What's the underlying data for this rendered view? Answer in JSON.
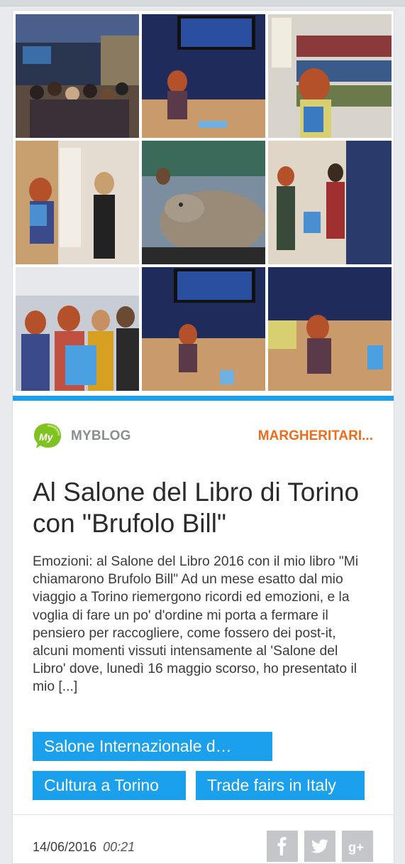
{
  "gallery": {
    "tiles": [
      {
        "scene": "audience-hall"
      },
      {
        "scene": "speaker-screen"
      },
      {
        "scene": "author-bookshelf"
      },
      {
        "scene": "booth-reader"
      },
      {
        "scene": "dinosaur-exhibit"
      },
      {
        "scene": "crowd-stand"
      },
      {
        "scene": "group-photo"
      },
      {
        "scene": "stage-wide"
      },
      {
        "scene": "stage-close"
      }
    ]
  },
  "post": {
    "blog_name": "MYBLOG",
    "author": "MARGHERITARI...",
    "title": "Al Salone del Libro di Torino con \"Brufolo Bill\"",
    "excerpt": "Emozioni: al Salone del Libro 2016 con il mio libro \"Mi chiamarono Brufolo Bill\" Ad un mese esatto dal mio viaggio a Torino riemergono ricordi ed emozioni, e la voglia di fare un po' d'ordine mi porta a fermare il pensiero per raccogliere, come fossero dei post-it, alcuni momenti vissuti intensamente al 'Salone del Libro' dove, lunedì 16 maggio scorso, ho presentato il mio [...]",
    "tags": [
      "Salone Internazionale d…",
      "Cultura a Torino",
      "Trade fairs in Italy"
    ],
    "date": "14/06/2016",
    "time": "00:21"
  },
  "share": {
    "icons": [
      "facebook-icon",
      "twitter-icon",
      "google-plus-icon"
    ]
  },
  "colors": {
    "accent": "#1aa0ec",
    "author": "#ef6c1a",
    "logo_green": "#7ec322"
  }
}
